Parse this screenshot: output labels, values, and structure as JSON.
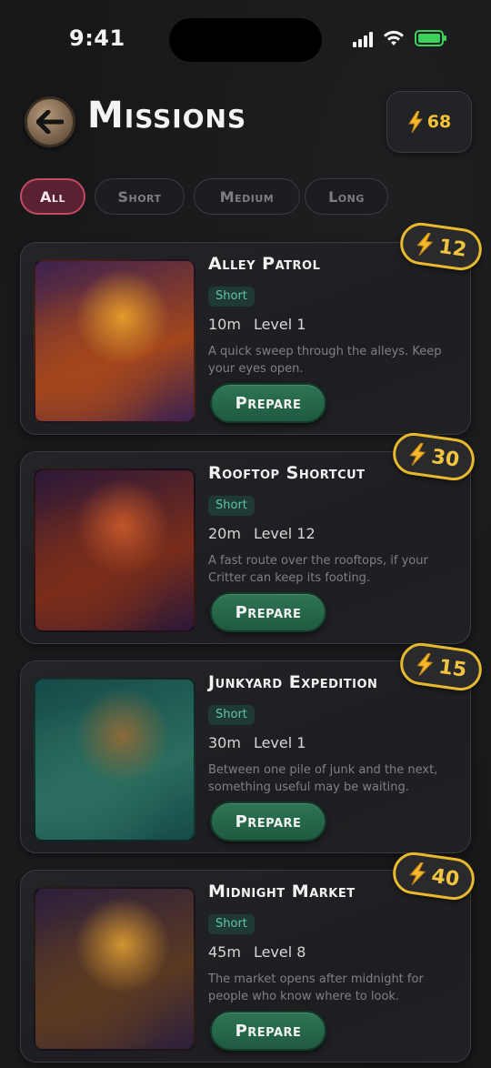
{
  "status": {
    "time": "9:41"
  },
  "header": {
    "title": "Missions",
    "energy": "68"
  },
  "filters": [
    {
      "label": "All",
      "active": true
    },
    {
      "label": "Short",
      "active": false
    },
    {
      "label": "Medium",
      "active": false
    },
    {
      "label": "Long",
      "active": false
    }
  ],
  "missions": [
    {
      "title": "Alley Patrol",
      "duration_type": "Short",
      "time": "10m",
      "level": "Level 1",
      "description": "A quick sweep through the alleys. Keep your eyes open.",
      "reward": "12",
      "button": "Prepare",
      "palette": [
        "#3b2150",
        "#a3461c",
        "#e49a2a"
      ]
    },
    {
      "title": "Rooftop Shortcut",
      "duration_type": "Short",
      "time": "20m",
      "level": "Level 12",
      "description": "A fast route over the rooftops, if your Critter can keep its footing.",
      "reward": "30",
      "button": "Prepare",
      "palette": [
        "#2a1838",
        "#7a2d1a",
        "#c2562a"
      ]
    },
    {
      "title": "Junkyard Expedition",
      "duration_type": "Short",
      "time": "30m",
      "level": "Level 1",
      "description": "Between one pile of junk and the next, something useful may be waiting.",
      "reward": "15",
      "button": "Prepare",
      "palette": [
        "#154a48",
        "#2b6d5e",
        "#8a6a3a"
      ]
    },
    {
      "title": "Midnight Market",
      "duration_type": "Short",
      "time": "45m",
      "level": "Level 8",
      "description": "The market opens after midnight for people who know where to look.",
      "reward": "40",
      "button": "Prepare",
      "palette": [
        "#2c1f3c",
        "#5b3a22",
        "#d29432"
      ]
    }
  ]
}
